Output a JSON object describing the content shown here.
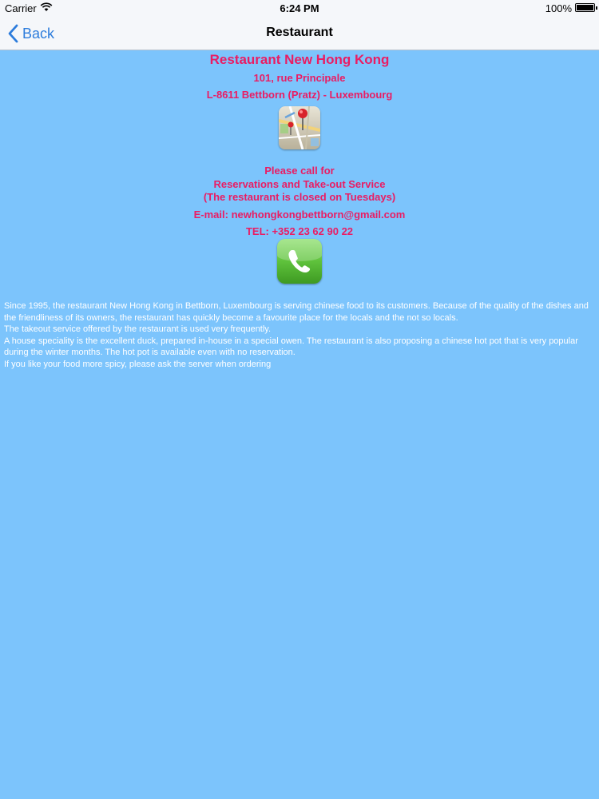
{
  "status_bar": {
    "carrier": "Carrier",
    "time": "6:24 PM",
    "battery": "100%"
  },
  "nav": {
    "back_label": "Back",
    "title": "Restaurant"
  },
  "restaurant": {
    "name": "Restaurant New Hong Kong",
    "address_line1": "101, rue Principale",
    "address_line2": "L-8611 Bettborn (Pratz) - Luxembourg",
    "call_line1": "Please call for",
    "call_line2": "Reservations and Take-out Service",
    "call_line3": "(The restaurant is closed on Tuesdays)",
    "email": "E-mail: newhongkongbettborn@gmail.com",
    "tel": "TEL: +352 23 62 90 22"
  },
  "description": [
    "Since 1995, the restaurant New Hong Kong in Bettborn, Luxembourg is serving chinese food to its customers. Because of the quality of the dishes and the friendliness of its owners, the restaurant has quickly become a favourite place for the locals and the not so locals.",
    "The takeout service offered by the restaurant is used very frequently.",
    "A house speciality is the excellent duck, prepared in-house in a special owen. The restaurant is also proposing a chinese hot pot that is very popular during the winter months. The hot pot is available even with no reservation.",
    "If you like your food more spicy, please ask the server when ordering"
  ],
  "colors": {
    "background": "#7cc4fc",
    "accent_text": "#ea1c63",
    "nav_tint": "#2c7cdc"
  },
  "icons": {
    "map": "maps-icon",
    "phone": "phone-icon"
  }
}
